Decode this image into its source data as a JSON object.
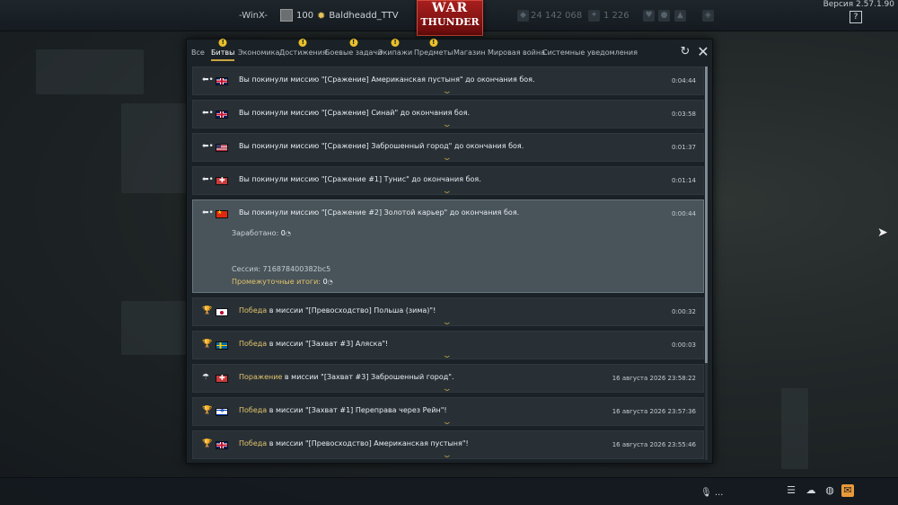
{
  "version": "Версия 2.57.1.90",
  "topbar": {
    "nickname": "-WinX-",
    "player_level": "100",
    "player_name": "Baldheadd_TTV",
    "logo_line1": "WAR",
    "logo_line2": "THUNDER",
    "silver_lions": "24 142 068",
    "golden_eagles": "1 226"
  },
  "tabs": [
    {
      "label": "Все",
      "warning": false
    },
    {
      "label": "Битвы",
      "warning": true,
      "active": true
    },
    {
      "label": "Экономика",
      "warning": false
    },
    {
      "label": "Достижения",
      "warning": true
    },
    {
      "label": "Боевые задачи",
      "warning": true
    },
    {
      "label": "Экипажи",
      "warning": true
    },
    {
      "label": "Предметы",
      "warning": true
    },
    {
      "label": "Магазин",
      "warning": false
    },
    {
      "label": "Мировая война",
      "warning": false
    },
    {
      "label": "Системные уведомления",
      "warning": false
    }
  ],
  "warning_mark": "!",
  "messages": [
    {
      "icon": "exit-icon",
      "flag": "gb",
      "highlight": "",
      "text": "Вы покинули миссию \"[Сражение] Американская пустыня\" до окончания боя.",
      "time": "0:04:44"
    },
    {
      "icon": "exit-icon",
      "flag": "gb",
      "highlight": "",
      "text": "Вы покинули миссию \"[Сражение] Синай\" до окончания боя.",
      "time": "0:03:58"
    },
    {
      "icon": "exit-icon",
      "flag": "us",
      "highlight": "",
      "text": "Вы покинули миссию \"[Сражение] Заброшенный город\" до окончания боя.",
      "time": "0:01:37"
    },
    {
      "icon": "exit-icon",
      "flag": "de",
      "highlight": "",
      "text": "Вы покинули миссию \"[Сражение #1] Тунис\" до окончания боя.",
      "time": "0:01:14"
    },
    {
      "icon": "exit-icon",
      "flag": "cn",
      "highlight": "",
      "text": "Вы покинули миссию \"[Сражение #2] Золотой карьер\" до окончания боя.",
      "time": "0:00:44",
      "expanded": true
    },
    {
      "icon": "trophy-icon",
      "flag": "jp",
      "highlight": "Победа",
      "text": " в миссии \"[Превосходство] Польша (зима)\"!",
      "time": "0:00:32"
    },
    {
      "icon": "trophy-icon",
      "flag": "se",
      "highlight": "Победа",
      "text": " в миссии \"[Захват #3] Аляска\"!",
      "time": "0:00:03"
    },
    {
      "icon": "parachute-icon",
      "flag": "de",
      "highlight": "Поражение",
      "text": " в миссии \"[Захват #3] Заброшенный город\".",
      "time": "16 августа 2026 23:58:22"
    },
    {
      "icon": "trophy-icon",
      "flag": "il",
      "highlight": "Победа",
      "text": " в миссии \"[Захват #1] Переправа через Рейн\"!",
      "time": "16 августа 2026 23:57:36"
    },
    {
      "icon": "trophy-icon",
      "flag": "gb",
      "highlight": "Победа",
      "text": " в миссии \"[Превосходство] Американская пустыня\"!",
      "time": "16 августа 2026 23:55:46"
    }
  ],
  "expanded_details": {
    "earned_label": "Заработано:",
    "earned_value": "0",
    "session_label": "Сессия: 716878400382bc5",
    "interim_label": "Промежуточные итоги:",
    "interim_value": "0"
  },
  "bottombar": {
    "mic_label": "..."
  }
}
